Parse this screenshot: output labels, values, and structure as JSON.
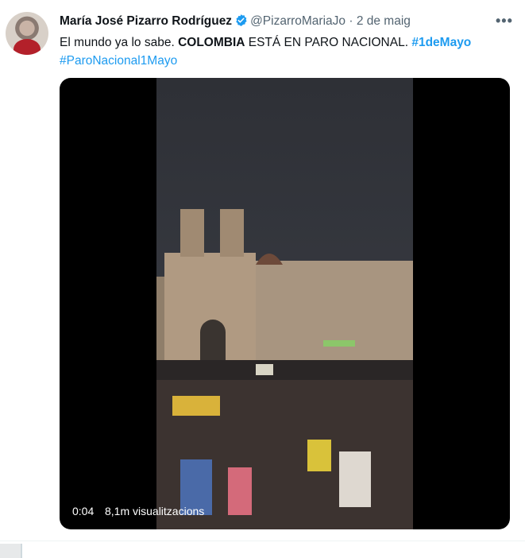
{
  "tweet": {
    "author_name": "María José Pizarro Rodríguez",
    "handle": "@PizarroMariaJo",
    "separator": " · ",
    "date": "2 de maig",
    "more_label": "•••",
    "text_intro": "El mundo ya lo sabe.  ",
    "text_bold": "COLOMBIA",
    "text_rest": " ESTÁ EN PARO NACIONAL. ",
    "hashtags": [
      "#1deMayo",
      "#ParoNacional1Mayo"
    ]
  },
  "video": {
    "time": "0:04",
    "views": "8,1m visualitzacions"
  },
  "colors": {
    "accent": "#1d9bf0",
    "text": "#0f1419",
    "muted": "#536471"
  },
  "icons": {
    "verified": "verified-badge-icon",
    "more": "more-horizontal-icon"
  }
}
